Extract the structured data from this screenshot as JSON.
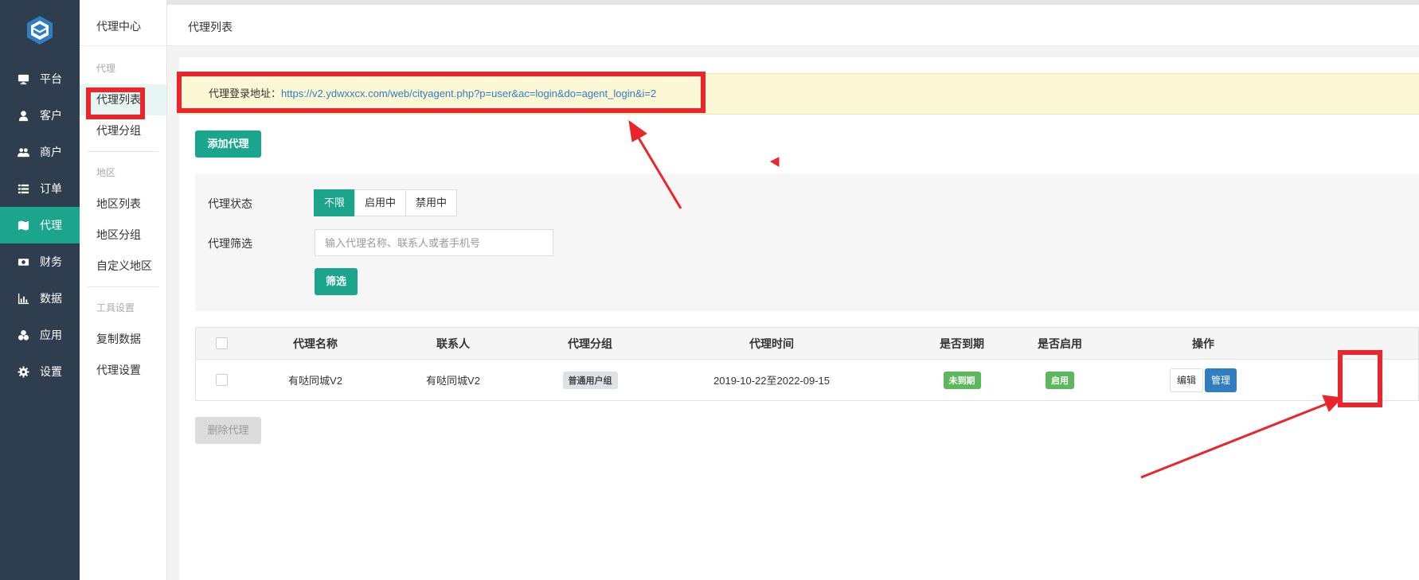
{
  "sidebar": {
    "items": [
      {
        "label": "平台",
        "icon": "monitor-icon"
      },
      {
        "label": "客户",
        "icon": "user-icon"
      },
      {
        "label": "商户",
        "icon": "users-icon"
      },
      {
        "label": "订单",
        "icon": "list-icon"
      },
      {
        "label": "代理",
        "icon": "map-icon",
        "active": true
      },
      {
        "label": "财务",
        "icon": "money-icon"
      },
      {
        "label": "数据",
        "icon": "bar-chart-icon"
      },
      {
        "label": "应用",
        "icon": "cubes-icon"
      },
      {
        "label": "设置",
        "icon": "gear-icon"
      }
    ]
  },
  "subnav": {
    "title": "代理中心",
    "groups": [
      {
        "label": "代理",
        "items": [
          "代理列表",
          "代理分组"
        ]
      },
      {
        "label": "地区",
        "items": [
          "地区列表",
          "地区分组",
          "自定义地区"
        ]
      },
      {
        "label": "工具设置",
        "items": [
          "复制数据",
          "代理设置"
        ]
      }
    ]
  },
  "header": {
    "title": "代理列表"
  },
  "notice": {
    "label": "代理登录地址：",
    "url": "https://v2.ydwxxcx.com/web/cityagent.php?p=user&ac=login&do=agent_login&i=2"
  },
  "add_button": "添加代理",
  "filter": {
    "status_label": "代理状态",
    "status_options": [
      "不限",
      "启用中",
      "禁用中"
    ],
    "search_label": "代理筛选",
    "search_placeholder": "输入代理名称、联系人或者手机号",
    "submit_label": "筛选"
  },
  "table": {
    "headers": [
      "代理名称",
      "联系人",
      "代理分组",
      "代理时间",
      "是否到期",
      "是否启用",
      "操作"
    ],
    "rows": [
      {
        "name": "有哒同城V2",
        "contact": "有哒同城V2",
        "group": "普通用户组",
        "time": "2019-10-22至2022-09-15",
        "expired": "未到期",
        "enabled": "启用",
        "edit": "编辑",
        "manage": "管理"
      }
    ]
  },
  "delete_button": "删除代理",
  "colors": {
    "sidebar": "#2f3e4f",
    "accent": "#1aa58c",
    "blue": "#2f7dc2",
    "annotation": "#e8262b"
  }
}
